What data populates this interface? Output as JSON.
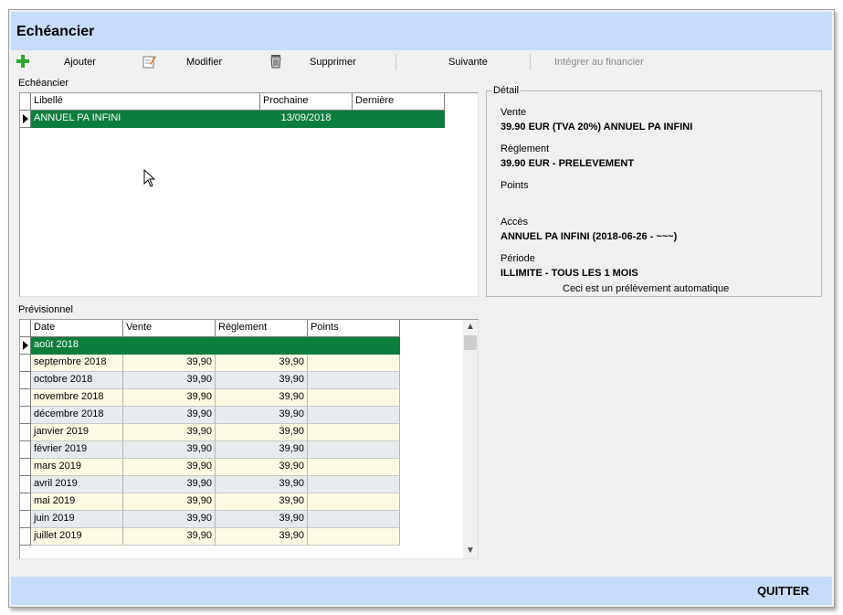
{
  "window": {
    "title": "Echéancier"
  },
  "toolbar": {
    "add": "Ajouter",
    "edit": "Modifier",
    "delete": "Supprimer",
    "next": "Suivante",
    "integrate": "Intégrer au financier"
  },
  "echeancier": {
    "label": "Echéancier",
    "columns": [
      "Libellé",
      "Prochaine",
      "Dernière"
    ],
    "rows": [
      {
        "libelle": "ANNUEL PA INFINI",
        "prochaine": "13/09/2018",
        "derniere": ""
      }
    ]
  },
  "detail": {
    "legend": "Détail",
    "vente_label": "Vente",
    "vente_value": "39.90 EUR (TVA 20%) ANNUEL PA INFINI",
    "reglement_label": "Règlement",
    "reglement_value": "39.90 EUR - PRELEVEMENT",
    "points_label": "Points",
    "acces_label": "Accès",
    "acces_value": "ANNUEL PA INFINI (2018-06-26 - ~~~)",
    "periode_label": "Période",
    "periode_value": "ILLIMITE - TOUS LES 1 MOIS",
    "note": "Ceci est un prélèvement automatique"
  },
  "previsionnel": {
    "label": "Prévisionnel",
    "columns": [
      "Date",
      "Vente",
      "Règlement",
      "Points"
    ],
    "rows": [
      {
        "date": "août 2018",
        "vente": "",
        "reglement": "",
        "points": ""
      },
      {
        "date": "septembre 2018",
        "vente": "39,90",
        "reglement": "39,90",
        "points": ""
      },
      {
        "date": "octobre 2018",
        "vente": "39,90",
        "reglement": "39,90",
        "points": ""
      },
      {
        "date": "novembre 2018",
        "vente": "39,90",
        "reglement": "39,90",
        "points": ""
      },
      {
        "date": "décembre 2018",
        "vente": "39,90",
        "reglement": "39,90",
        "points": ""
      },
      {
        "date": "janvier 2019",
        "vente": "39,90",
        "reglement": "39,90",
        "points": ""
      },
      {
        "date": "février 2019",
        "vente": "39,90",
        "reglement": "39,90",
        "points": ""
      },
      {
        "date": "mars 2019",
        "vente": "39,90",
        "reglement": "39,90",
        "points": ""
      },
      {
        "date": "avril 2019",
        "vente": "39,90",
        "reglement": "39,90",
        "points": ""
      },
      {
        "date": "mai 2019",
        "vente": "39,90",
        "reglement": "39,90",
        "points": ""
      },
      {
        "date": "juin 2019",
        "vente": "39,90",
        "reglement": "39,90",
        "points": ""
      },
      {
        "date": "juillet 2019",
        "vente": "39,90",
        "reglement": "39,90",
        "points": ""
      }
    ]
  },
  "footer": {
    "quit": "QUITTER"
  },
  "colors": {
    "header_blue": "#c6dcfb",
    "selection_green": "#0b7d3d",
    "row_yellow": "#fdfbe3",
    "row_gray": "#e6ebee"
  }
}
